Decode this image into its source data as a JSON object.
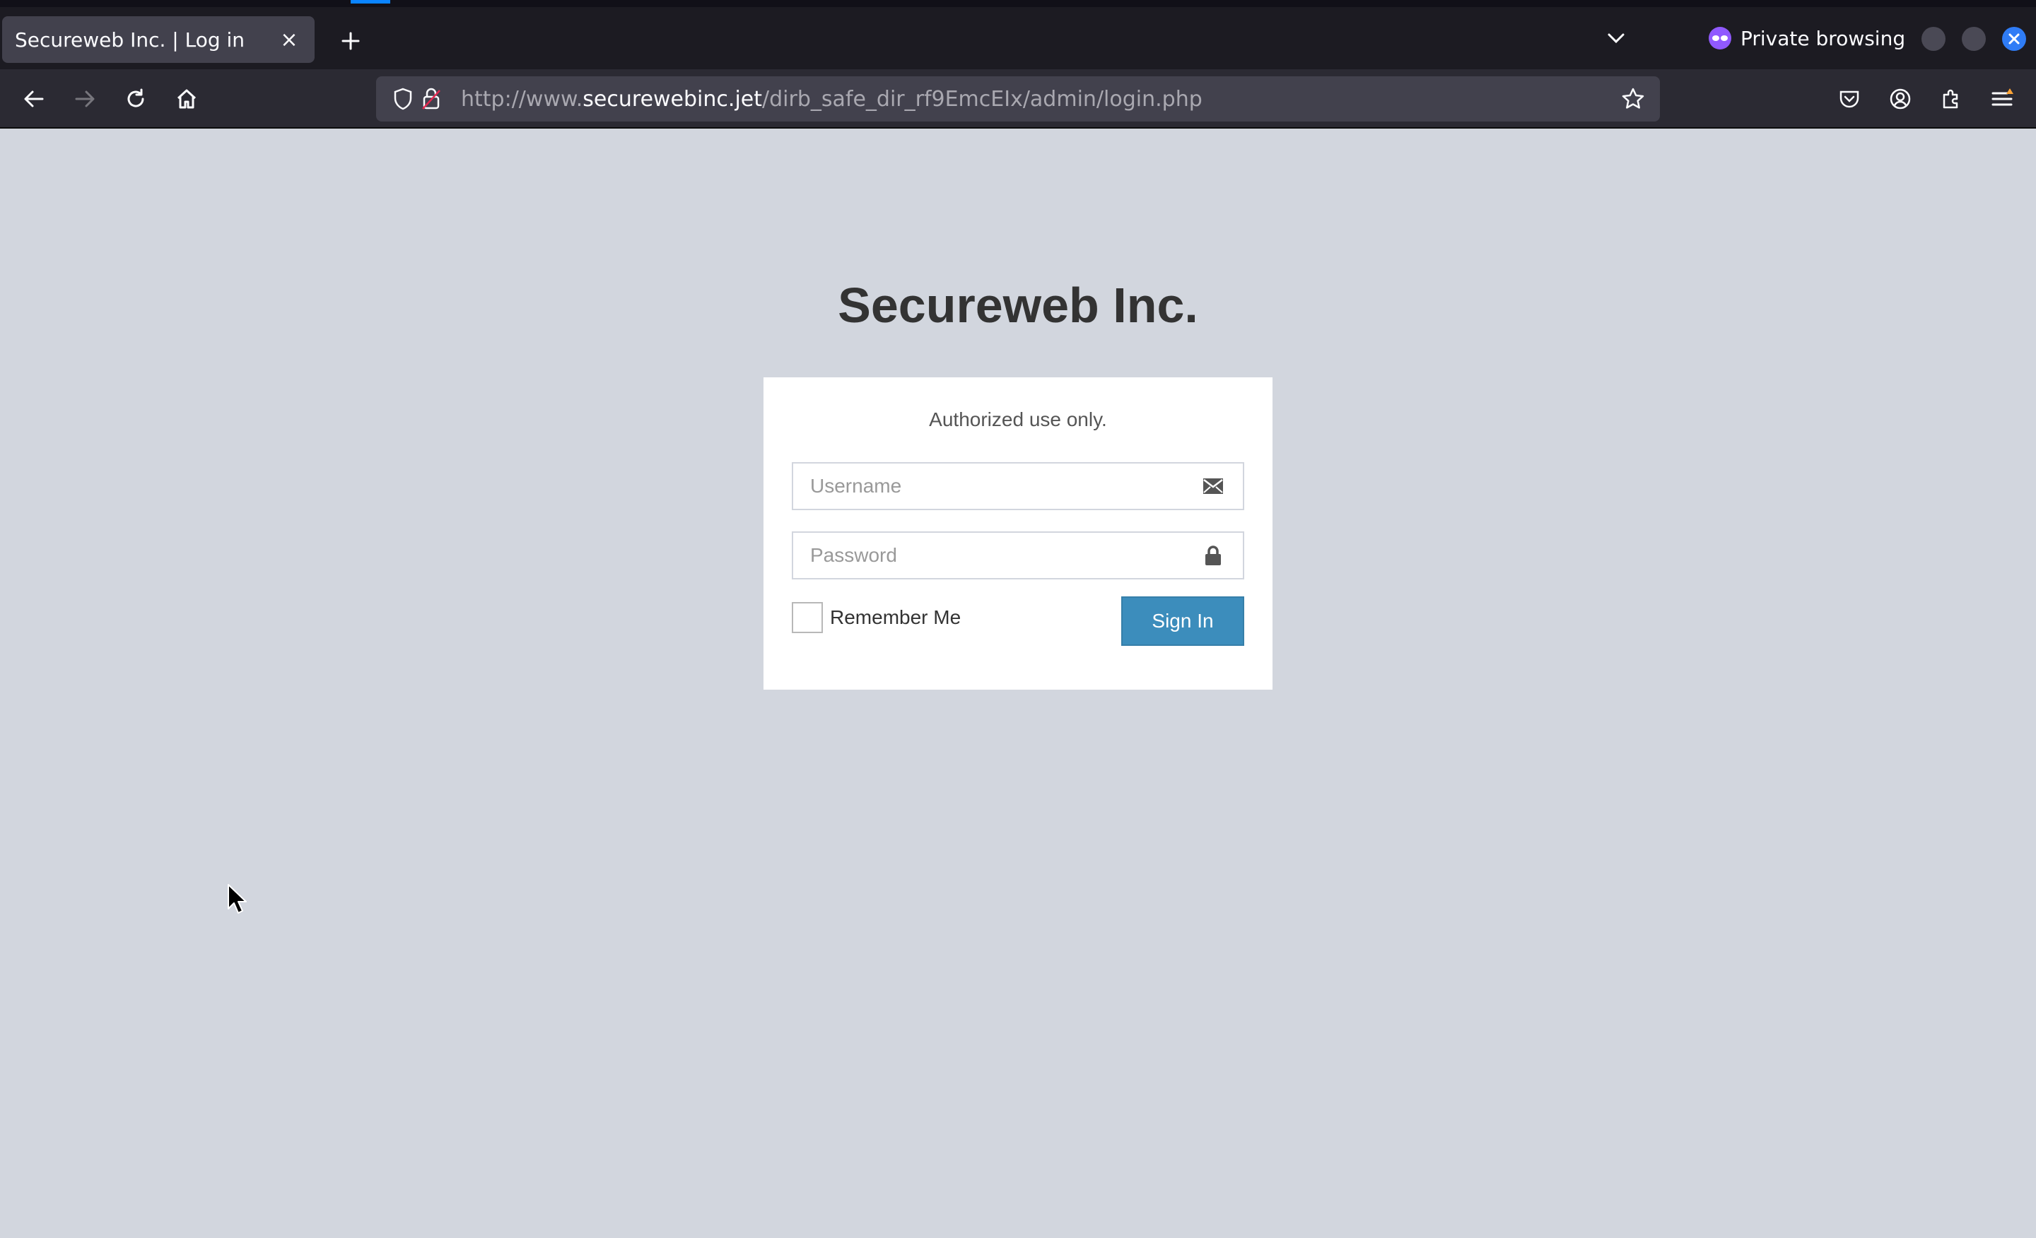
{
  "browser": {
    "tab_title": "Secureweb Inc. | Log in",
    "tab_close": "×",
    "private_label": "Private browsing",
    "url_prefix": "http://www.",
    "url_domain": "securewebinc.jet",
    "url_path": "/dirb_safe_dir_rf9EmcEIx/admin/login.php"
  },
  "page": {
    "brand": "Secureweb Inc.",
    "message": "Authorized use only.",
    "username_placeholder": "Username",
    "password_placeholder": "Password",
    "remember_label": "Remember Me",
    "signin_label": "Sign In"
  },
  "colors": {
    "page_bg": "#d2d6de",
    "button": "#3c8dbc",
    "chrome_dark": "#1c1b22",
    "private_accent": "#9059ff"
  }
}
